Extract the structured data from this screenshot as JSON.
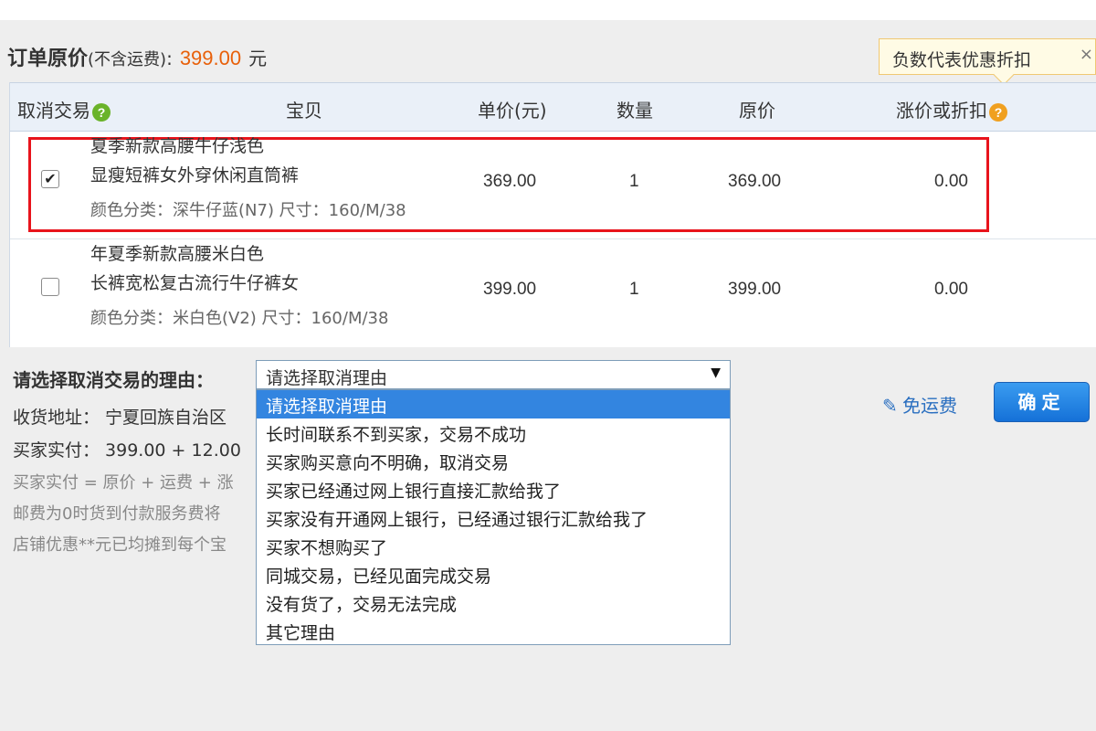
{
  "order": {
    "title": "订单原价",
    "subtitle": "(不含运费)",
    "colon": ":",
    "amount": "399.00",
    "unit": "元"
  },
  "tooltip": {
    "text": "负数代表优惠折扣",
    "close": "×"
  },
  "table": {
    "headers": [
      "取消交易",
      "宝贝",
      "单价(元)",
      "数量",
      "原价",
      "涨价或折扣"
    ],
    "rows": [
      {
        "checked": true,
        "check_mark": "✔",
        "title_line1": "夏季新款高腰牛仔浅色",
        "title_line2": "显瘦短裤女外穿休闲直筒裤",
        "sku": "颜色分类：深牛仔蓝(N7)  尺寸：160/M/38",
        "price": "369.00",
        "qty": "1",
        "original": "369.00",
        "discount": "0.00"
      },
      {
        "checked": false,
        "check_mark": "",
        "title_line1": "年夏季新款高腰米白色",
        "title_line2": "长裤宽松复古流行牛仔裤女",
        "sku": "颜色分类：米白色(V2)  尺寸：160/M/38",
        "price": "399.00",
        "qty": "1",
        "original": "399.00",
        "discount": "0.00"
      }
    ]
  },
  "form": {
    "reason_label": "请选择取消交易的理由：",
    "select_value": "请选择取消理由",
    "options": [
      "请选择取消理由",
      "长时间联系不到买家，交易不成功",
      "买家购买意向不明确，取消交易",
      "买家已经通过网上银行直接汇款给我了",
      "买家没有开通网上银行，已经通过银行汇款给我了",
      "买家不想购买了",
      "同城交易，已经见面完成交易",
      "没有货了，交易无法完成",
      "其它理由"
    ]
  },
  "info": {
    "address": "收货地址：  宁夏回族自治区",
    "paid": "买家实付：  399.00 + 12.00",
    "formula": "买家实付 = 原价 + 运费 + 涨",
    "shipping_note": "邮费为0时货到付款服务费将",
    "coupon_note": "店铺优惠**元已均摊到每个宝"
  },
  "actions": {
    "free_shipping": "免运费",
    "confirm": "确定"
  },
  "icons": {
    "help": "?",
    "pencil": "✎",
    "dropdown_arrow": "▼"
  }
}
